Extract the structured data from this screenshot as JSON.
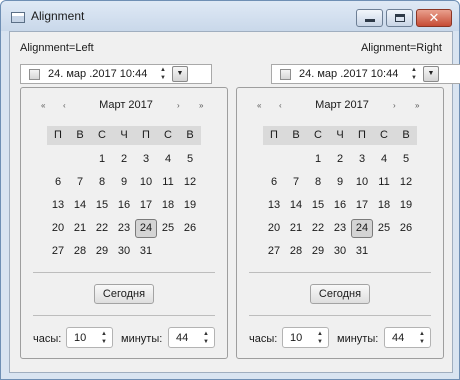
{
  "window": {
    "title": "Alignment"
  },
  "labels": {
    "left": "Alignment=Left",
    "right": "Alignment=Right"
  },
  "date_value": "24. мар .2017 10:44",
  "calendar": {
    "month_title": "Март 2017",
    "weekdays": [
      "П",
      "В",
      "С",
      "Ч",
      "П",
      "С",
      "В"
    ],
    "rows": [
      [
        "",
        "",
        "1",
        "2",
        "3",
        "4",
        "5"
      ],
      [
        "6",
        "7",
        "8",
        "9",
        "10",
        "11",
        "12"
      ],
      [
        "13",
        "14",
        "15",
        "16",
        "17",
        "18",
        "19"
      ],
      [
        "20",
        "21",
        "22",
        "23",
        "24",
        "25",
        "26"
      ],
      [
        "27",
        "28",
        "29",
        "30",
        "31",
        "",
        ""
      ]
    ],
    "selected_day": "24",
    "today_label": "Сегодня",
    "hours_label": "часы:",
    "minutes_label": "минуты:",
    "hours_value": "10",
    "minutes_value": "44"
  },
  "icons": {
    "first": "«",
    "prev": "‹",
    "next": "›",
    "last": "»",
    "up": "▲",
    "down": "▼",
    "dropdown": "▼",
    "close": "✕"
  },
  "colors": {
    "title_bar": "#dfe9f5",
    "close_button": "#c64c35",
    "selected_day": "#d4d4d4"
  }
}
